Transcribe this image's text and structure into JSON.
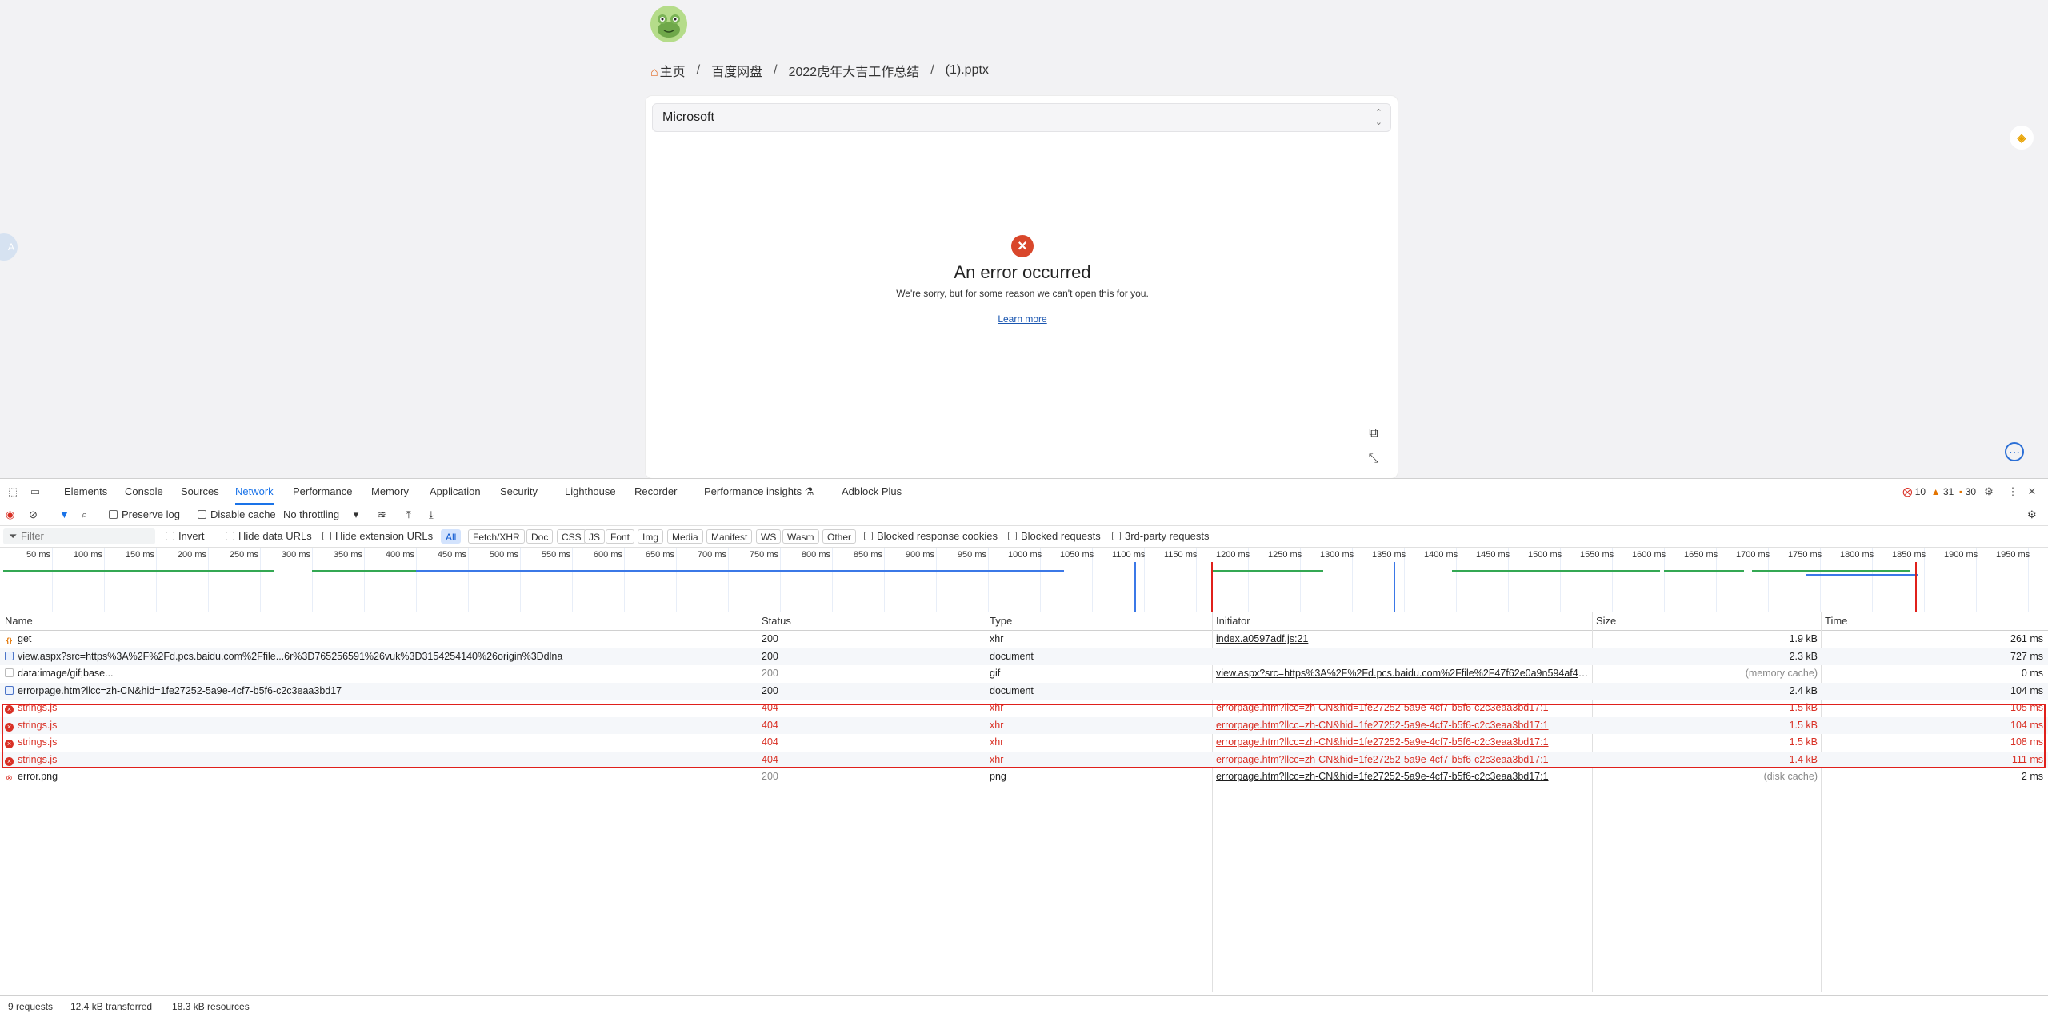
{
  "page": {
    "breadcrumb": [
      "主页",
      "百度网盘",
      "2022虎年大吉工作总结",
      "(1).pptx"
    ],
    "separator": "/",
    "viewer": {
      "select_value": "Microsoft",
      "error_title": "An error occurred",
      "error_desc": "We're sorry, but for some reason we can't open this for you.",
      "learn_more": "Learn more"
    }
  },
  "devtools": {
    "tabs": [
      "Elements",
      "Console",
      "Sources",
      "Network",
      "Performance",
      "Memory",
      "Application",
      "Security",
      "Lighthouse",
      "Recorder",
      "Performance insights",
      "Adblock Plus"
    ],
    "active_tab": "Network",
    "counts": {
      "errors": "10",
      "warnings": "31",
      "info": "30"
    },
    "toolbar": {
      "preserve_log": "Preserve log",
      "disable_cache": "Disable cache",
      "throttling": "No throttling"
    },
    "filter": {
      "placeholder": "Filter",
      "invert": "Invert",
      "hide_data_urls": "Hide data URLs",
      "hide_extension_urls": "Hide extension URLs",
      "types": [
        "All",
        "Fetch/XHR",
        "Doc",
        "CSS",
        "JS",
        "Font",
        "Img",
        "Media",
        "Manifest",
        "WS",
        "Wasm",
        "Other"
      ],
      "blocked_response_cookies": "Blocked response cookies",
      "blocked_requests": "Blocked requests",
      "third_party": "3rd-party requests"
    },
    "timeline_labels": [
      "50 ms",
      "100 ms",
      "150 ms",
      "200 ms",
      "250 ms",
      "300 ms",
      "350 ms",
      "400 ms",
      "450 ms",
      "500 ms",
      "550 ms",
      "600 ms",
      "650 ms",
      "700 ms",
      "750 ms",
      "800 ms",
      "850 ms",
      "900 ms",
      "950 ms",
      "1000 ms",
      "1050 ms",
      "1100 ms",
      "1150 ms",
      "1200 ms",
      "1250 ms",
      "1300 ms",
      "1350 ms",
      "1400 ms",
      "1450 ms",
      "1500 ms",
      "1550 ms",
      "1600 ms",
      "1650 ms",
      "1700 ms",
      "1750 ms",
      "1800 ms",
      "1850 ms",
      "1900 ms",
      "1950 ms"
    ],
    "columns": [
      "Name",
      "Status",
      "Type",
      "Initiator",
      "Size",
      "Time"
    ],
    "rows": [
      {
        "name": "get",
        "status": "200",
        "type": "xhr",
        "initiator": "index.a0597adf.js:21",
        "size": "1.9 kB",
        "time": "261 ms",
        "icon": "xhr",
        "failed": false
      },
      {
        "name": "view.aspx?src=https%3A%2F%2Fd.pcs.baidu.com%2Ffile...6r%3D765256591%26vuk%3D3154254140%26origin%3Ddlna",
        "status": "200",
        "type": "document",
        "initiator": "",
        "size": "2.3 kB",
        "time": "727 ms",
        "icon": "doc",
        "failed": false
      },
      {
        "name": "data:image/gif;base...",
        "status": "200",
        "type": "gif",
        "initiator": "view.aspx?src=https%3A%2F%2Fd.pcs.baidu.com%2Ffile%2F47f62e0a9n594af4e...",
        "size": "(memory cache)",
        "time": "0 ms",
        "icon": "img",
        "failed": false
      },
      {
        "name": "errorpage.htm?llcc=zh-CN&hid=1fe27252-5a9e-4cf7-b5f6-c2c3eaa3bd17",
        "status": "200",
        "type": "document",
        "initiator": "",
        "size": "2.4 kB",
        "time": "104 ms",
        "icon": "doc",
        "failed": false
      },
      {
        "name": "strings.js",
        "status": "404",
        "type": "xhr",
        "initiator": "errorpage.htm?llcc=zh-CN&hid=1fe27252-5a9e-4cf7-b5f6-c2c3eaa3bd17:1",
        "size": "1.5 kB",
        "time": "105 ms",
        "icon": "err",
        "failed": true
      },
      {
        "name": "strings.js",
        "status": "404",
        "type": "xhr",
        "initiator": "errorpage.htm?llcc=zh-CN&hid=1fe27252-5a9e-4cf7-b5f6-c2c3eaa3bd17:1",
        "size": "1.5 kB",
        "time": "104 ms",
        "icon": "err",
        "failed": true
      },
      {
        "name": "strings.js",
        "status": "404",
        "type": "xhr",
        "initiator": "errorpage.htm?llcc=zh-CN&hid=1fe27252-5a9e-4cf7-b5f6-c2c3eaa3bd17:1",
        "size": "1.5 kB",
        "time": "108 ms",
        "icon": "err",
        "failed": true
      },
      {
        "name": "strings.js",
        "status": "404",
        "type": "xhr",
        "initiator": "errorpage.htm?llcc=zh-CN&hid=1fe27252-5a9e-4cf7-b5f6-c2c3eaa3bd17:1",
        "size": "1.4 kB",
        "time": "111 ms",
        "icon": "err",
        "failed": true
      },
      {
        "name": "error.png",
        "status": "200",
        "type": "png",
        "initiator": "errorpage.htm?llcc=zh-CN&hid=1fe27252-5a9e-4cf7-b5f6-c2c3eaa3bd17:1",
        "size": "(disk cache)",
        "time": "2 ms",
        "icon": "errsmall",
        "failed": false
      }
    ],
    "summary": {
      "requests": "9 requests",
      "transferred": "12.4 kB transferred",
      "resources": "18.3 kB resources"
    }
  },
  "colors": {
    "accent": "#1a73e8",
    "error": "#d93025",
    "highlight": "#e0201b"
  }
}
